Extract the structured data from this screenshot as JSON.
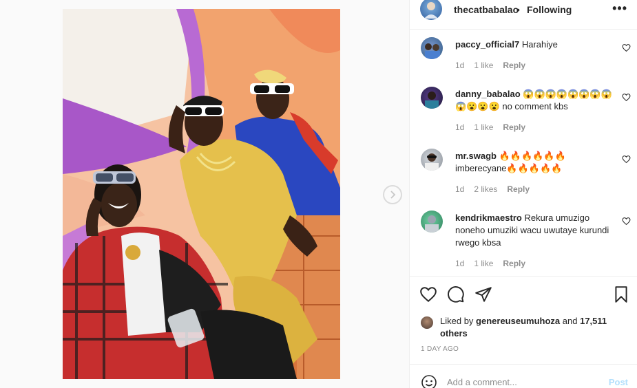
{
  "header": {
    "username": "thecatbabalao",
    "separator": "•",
    "follow_status": "Following",
    "more": "•••"
  },
  "comments": [
    {
      "username": "paccy_official7",
      "text": "Harahiye",
      "age": "1d",
      "likes": "1 like",
      "reply": "Reply"
    },
    {
      "username": "danny_babalao",
      "text": "😱😱😱😱😱😱😱😱😱😮😮😮 no comment kbs",
      "age": "1d",
      "likes": "1 like",
      "reply": "Reply"
    },
    {
      "username": "mr.swagb",
      "text": "🔥🔥🔥🔥🔥🔥 imberecyane🔥🔥🔥🔥🔥",
      "age": "1d",
      "likes": "2 likes",
      "reply": "Reply"
    },
    {
      "username": "kendrikmaestro",
      "text": "Rekura umuzigo noneho umuziki wacu uwutaye kurundi rwego kbsa",
      "age": "1d",
      "likes": "1 like",
      "reply": "Reply"
    }
  ],
  "likes": {
    "prefix": "Liked by",
    "user": "genereuseumuhoza",
    "conjunction": "and",
    "others": "17,511 others"
  },
  "timestamp": "1 DAY AGO",
  "add_comment": {
    "placeholder": "Add a comment...",
    "post_label": "Post"
  },
  "icons": {
    "like": "heart-icon",
    "comment": "comment-icon",
    "share": "paper-plane-icon",
    "save": "bookmark-icon",
    "next": "chevron-right-icon",
    "emoji": "smiley-icon"
  },
  "colors": {
    "text": "#262626",
    "muted": "#8e8e8e",
    "divider": "#efefef",
    "post_disabled": "#b2dffc"
  }
}
